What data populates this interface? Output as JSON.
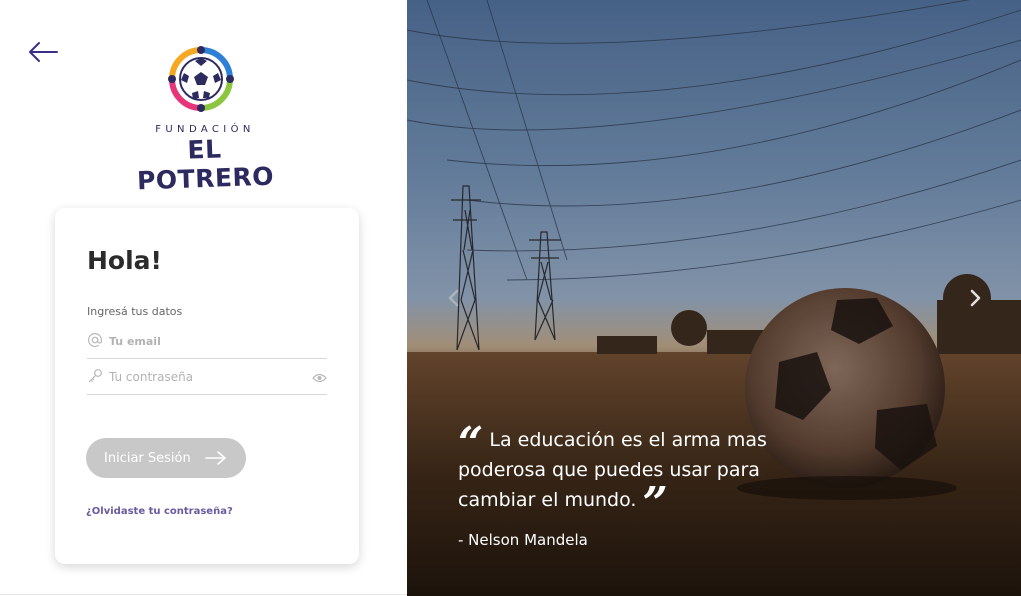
{
  "nav": {
    "back_icon": "arrow-left-icon"
  },
  "logo": {
    "top_text": "FUNDACIÓN",
    "main_text": "EL POTRERO"
  },
  "login": {
    "greeting": "Hola!",
    "subtitle": "Ingresá tus datos",
    "email_placeholder": "Tu email",
    "password_placeholder": "Tu contraseña",
    "submit_label": "Iniciar Sesión",
    "forgot_label": "¿Olvidaste tu contraseña?"
  },
  "hero": {
    "quote": "La educación es el arma mas poderosa que puedes usar para cambiar el mundo.",
    "author": "- Nelson Mandela"
  },
  "colors": {
    "brand": "#2c2a5e",
    "button_disabled": "#c8c8c8",
    "link": "#6a5aa0"
  }
}
